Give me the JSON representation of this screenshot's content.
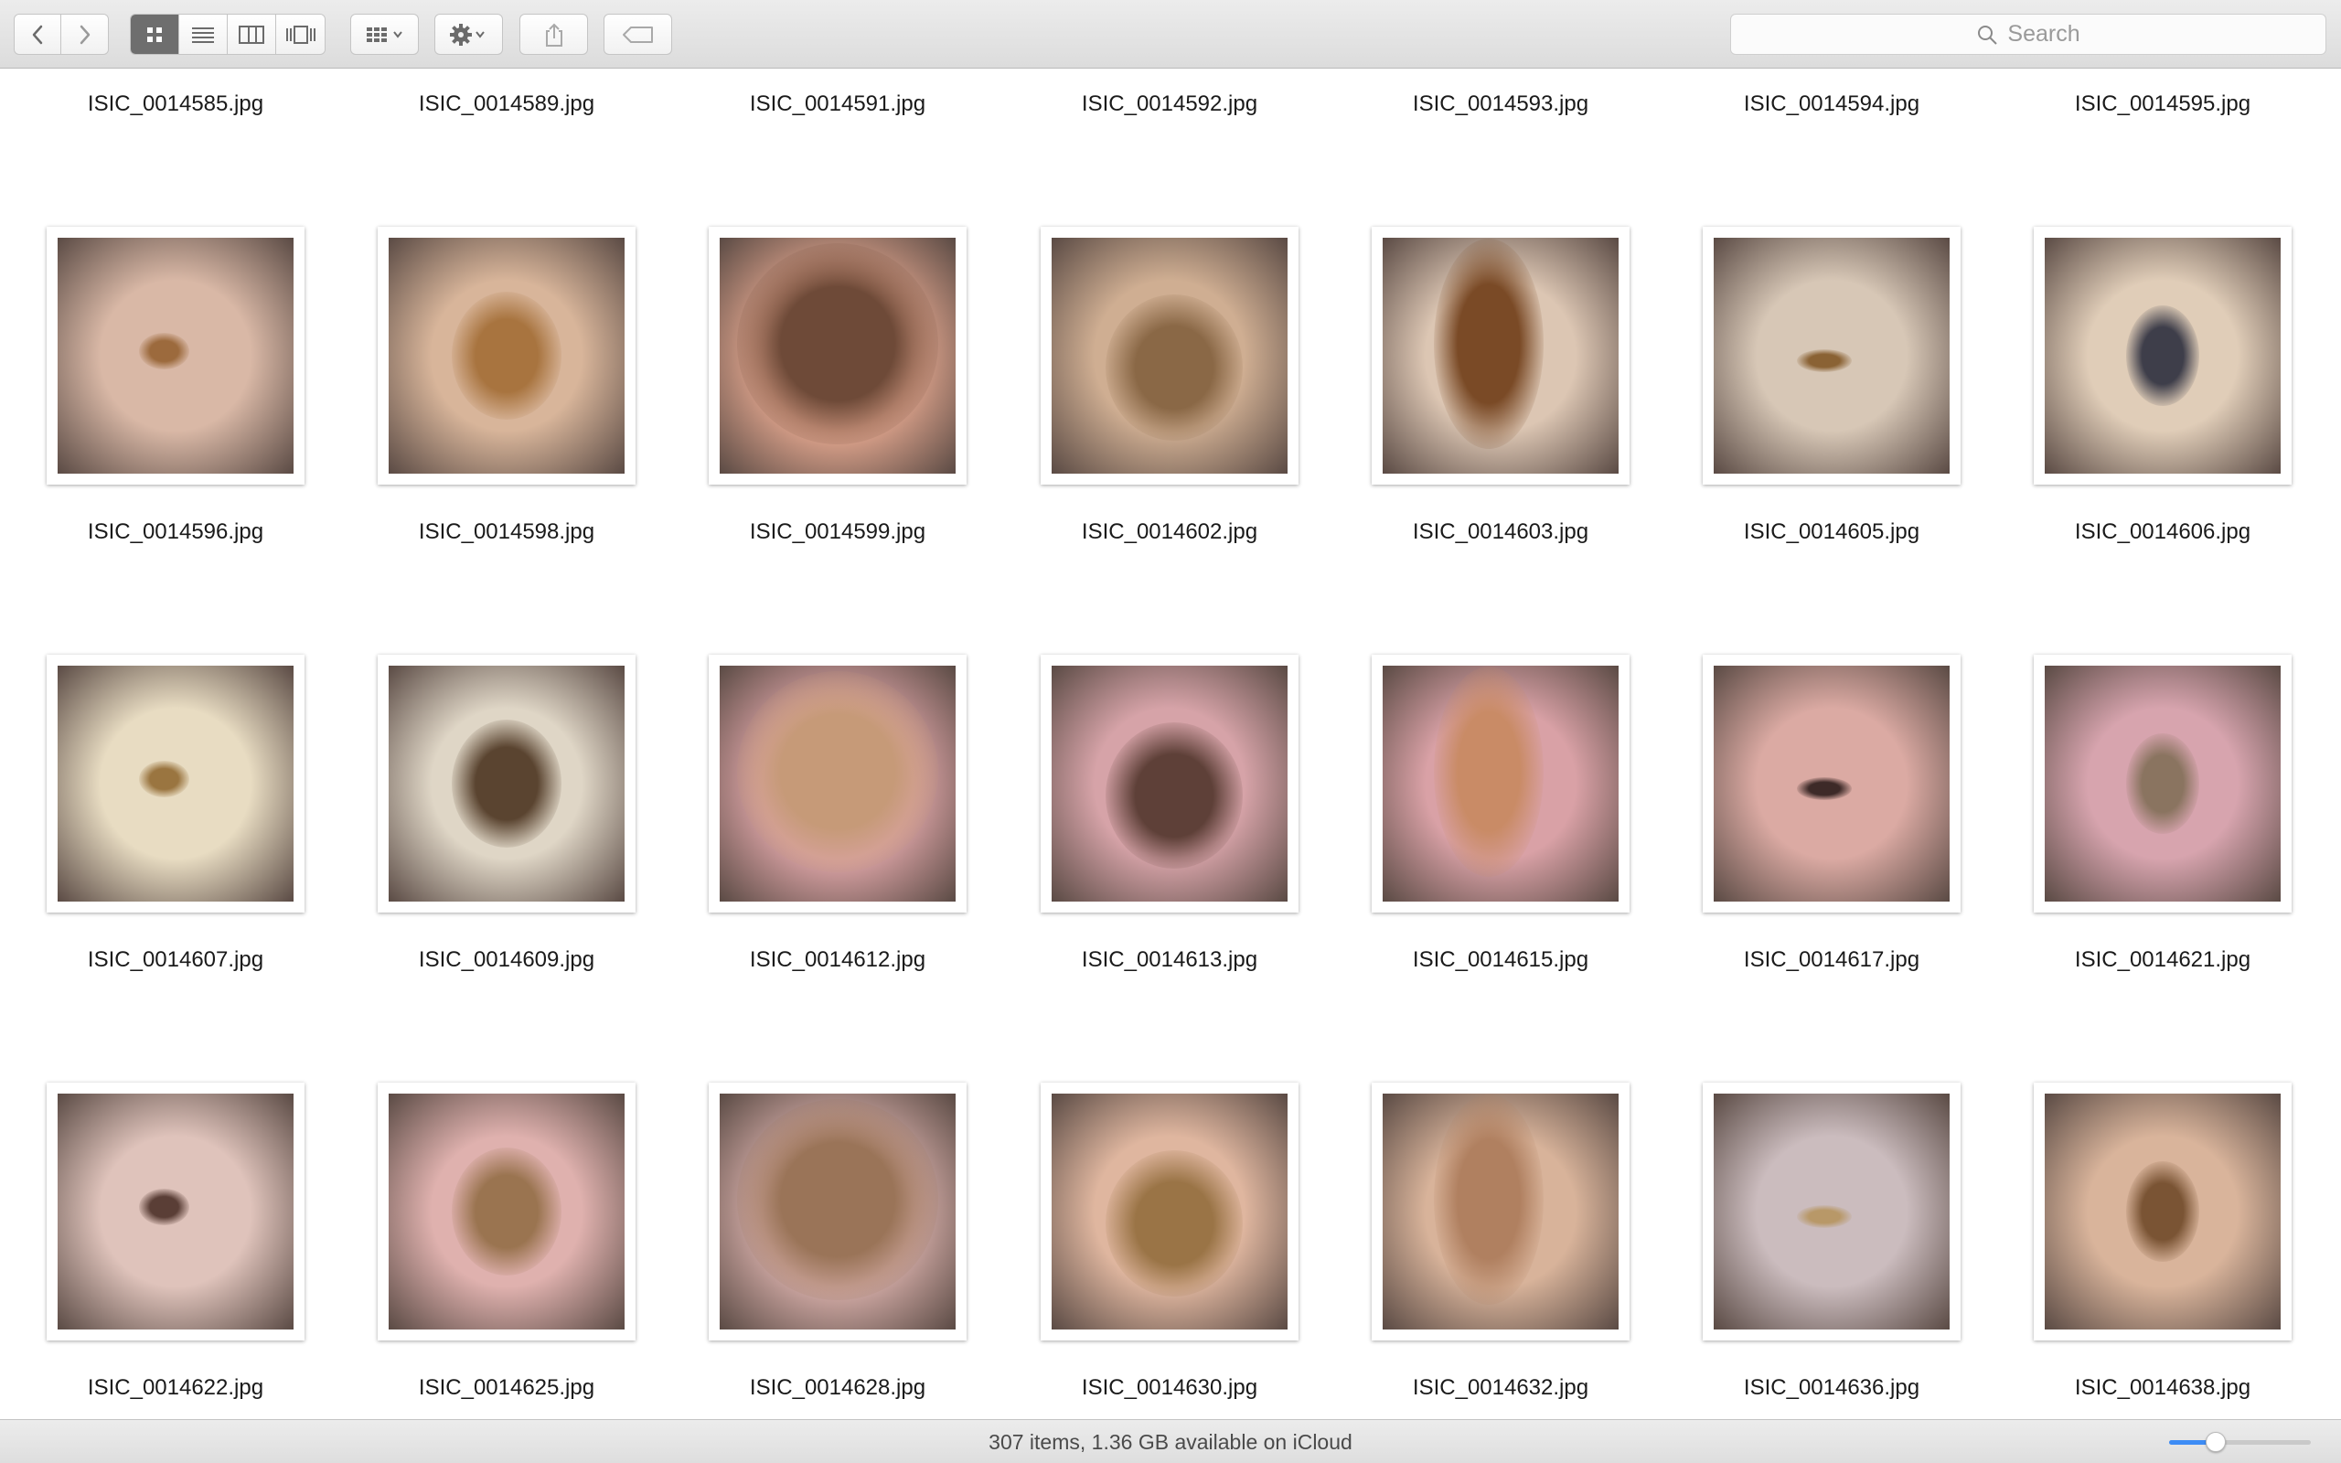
{
  "toolbar": {
    "nav": [
      "back-icon",
      "forward-icon"
    ],
    "view_modes": [
      "icon-view-icon",
      "list-view-icon",
      "column-view-icon",
      "coverflow-view-icon"
    ],
    "active_view": "icon-view-icon",
    "search_placeholder": "Search"
  },
  "files": [
    {
      "name": "ISIC_0014585.jpg"
    },
    {
      "name": "ISIC_0014589.jpg"
    },
    {
      "name": "ISIC_0014591.jpg"
    },
    {
      "name": "ISIC_0014592.jpg"
    },
    {
      "name": "ISIC_0014593.jpg"
    },
    {
      "name": "ISIC_0014594.jpg"
    },
    {
      "name": "ISIC_0014595.jpg"
    },
    {
      "name": "ISIC_0014596.jpg",
      "bg": "#d9b8a6",
      "lesion": "#9c6a3d"
    },
    {
      "name": "ISIC_0014598.jpg",
      "bg": "#d8b59a",
      "lesion": "#a8743f"
    },
    {
      "name": "ISIC_0014599.jpg",
      "bg": "#e3a78f",
      "lesion": "#6e4a38"
    },
    {
      "name": "ISIC_0014602.jpg",
      "bg": "#cfae92",
      "lesion": "#8a6846"
    },
    {
      "name": "ISIC_0014603.jpg",
      "bg": "#dcc6b3",
      "lesion": "#7a4a26"
    },
    {
      "name": "ISIC_0014605.jpg",
      "bg": "#d7c7b6",
      "lesion": "#8a6234"
    },
    {
      "name": "ISIC_0014606.jpg",
      "bg": "#e0cdb8",
      "lesion": "#3e3e4a"
    },
    {
      "name": "ISIC_0014607.jpg",
      "bg": "#e8dcc2",
      "lesion": "#9a7540"
    },
    {
      "name": "ISIC_0014609.jpg",
      "bg": "#dfd6c6",
      "lesion": "#5a4430"
    },
    {
      "name": "ISIC_0014612.jpg",
      "bg": "#dca4a6",
      "lesion": "#c69a78"
    },
    {
      "name": "ISIC_0014613.jpg",
      "bg": "#d6a3a8",
      "lesion": "#5e4038"
    },
    {
      "name": "ISIC_0014615.jpg",
      "bg": "#d9a1a6",
      "lesion": "#c98b66"
    },
    {
      "name": "ISIC_0014617.jpg",
      "bg": "#dbaaa3",
      "lesion": "#3d2a28"
    },
    {
      "name": "ISIC_0014621.jpg",
      "bg": "#d7a4ae",
      "lesion": "#8a7460"
    },
    {
      "name": "ISIC_0014622.jpg",
      "bg": "#dfc3bb",
      "lesion": "#5a3e36"
    },
    {
      "name": "ISIC_0014625.jpg",
      "bg": "#dfb1ae",
      "lesion": "#9a7450"
    },
    {
      "name": "ISIC_0014628.jpg",
      "bg": "#d6aea9",
      "lesion": "#9a7458"
    },
    {
      "name": "ISIC_0014630.jpg",
      "bg": "#dfb69f",
      "lesion": "#9a7446"
    },
    {
      "name": "ISIC_0014632.jpg",
      "bg": "#d8b39a",
      "lesion": "#b08060"
    },
    {
      "name": "ISIC_0014636.jpg",
      "bg": "#cbbcbe",
      "lesion": "#b89868"
    },
    {
      "name": "ISIC_0014638.jpg",
      "bg": "#d9b49b",
      "lesion": "#7a5434"
    }
  ],
  "status": {
    "text": "307 items, 1.36 GB available on iCloud",
    "zoom_level": 0.33
  }
}
